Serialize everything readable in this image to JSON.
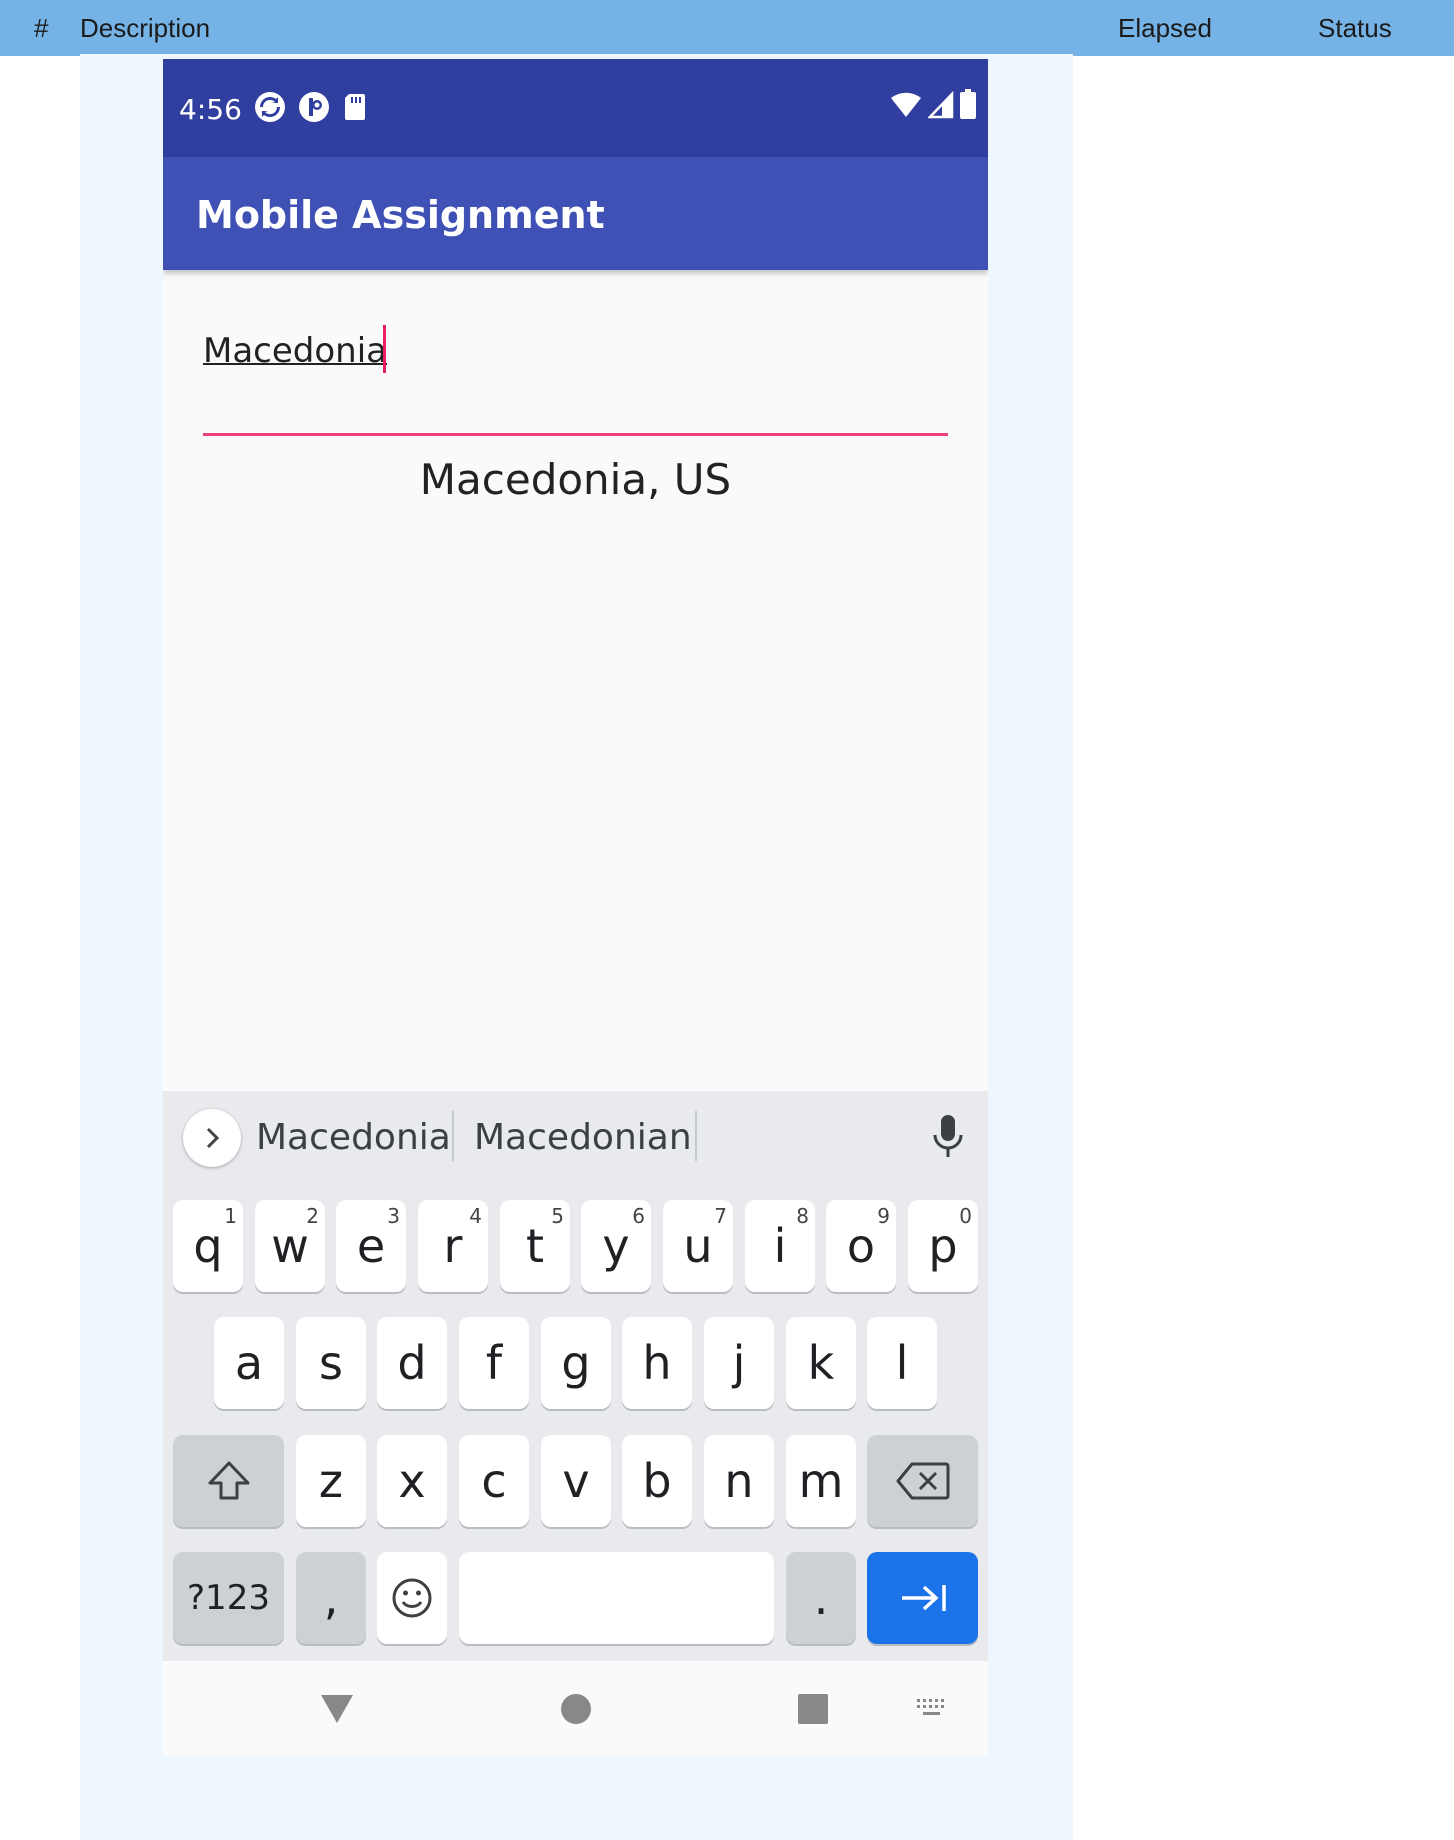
{
  "report": {
    "columns": {
      "num": "#",
      "description": "Description",
      "elapsed": "Elapsed",
      "status": "Status"
    }
  },
  "status_bar": {
    "time": "4:56",
    "icons": [
      "sync-icon",
      "app-icon",
      "sd-card-icon"
    ],
    "right_icons": [
      "wifi-icon",
      "signal-icon",
      "battery-icon"
    ]
  },
  "app": {
    "title": "Mobile Assignment"
  },
  "search": {
    "value": "Macedonia"
  },
  "result": {
    "text": "Macedonia, US"
  },
  "keyboard": {
    "suggestions": [
      "Macedonia",
      "Macedonian"
    ],
    "row1": [
      {
        "label": "q",
        "hint": "1"
      },
      {
        "label": "w",
        "hint": "2"
      },
      {
        "label": "e",
        "hint": "3"
      },
      {
        "label": "r",
        "hint": "4"
      },
      {
        "label": "t",
        "hint": "5"
      },
      {
        "label": "y",
        "hint": "6"
      },
      {
        "label": "u",
        "hint": "7"
      },
      {
        "label": "i",
        "hint": "8"
      },
      {
        "label": "o",
        "hint": "9"
      },
      {
        "label": "p",
        "hint": "0"
      }
    ],
    "row2": [
      "a",
      "s",
      "d",
      "f",
      "g",
      "h",
      "j",
      "k",
      "l"
    ],
    "row3": [
      "z",
      "x",
      "c",
      "v",
      "b",
      "n",
      "m"
    ],
    "symbols_label": "?123",
    "comma_label": ",",
    "period_label": "."
  },
  "colors": {
    "header_bg": "#75b2e6",
    "status_bar": "#303f9f",
    "app_bar": "#3f51b5",
    "accent": "#ec407a",
    "action_key": "#1a73e8"
  }
}
